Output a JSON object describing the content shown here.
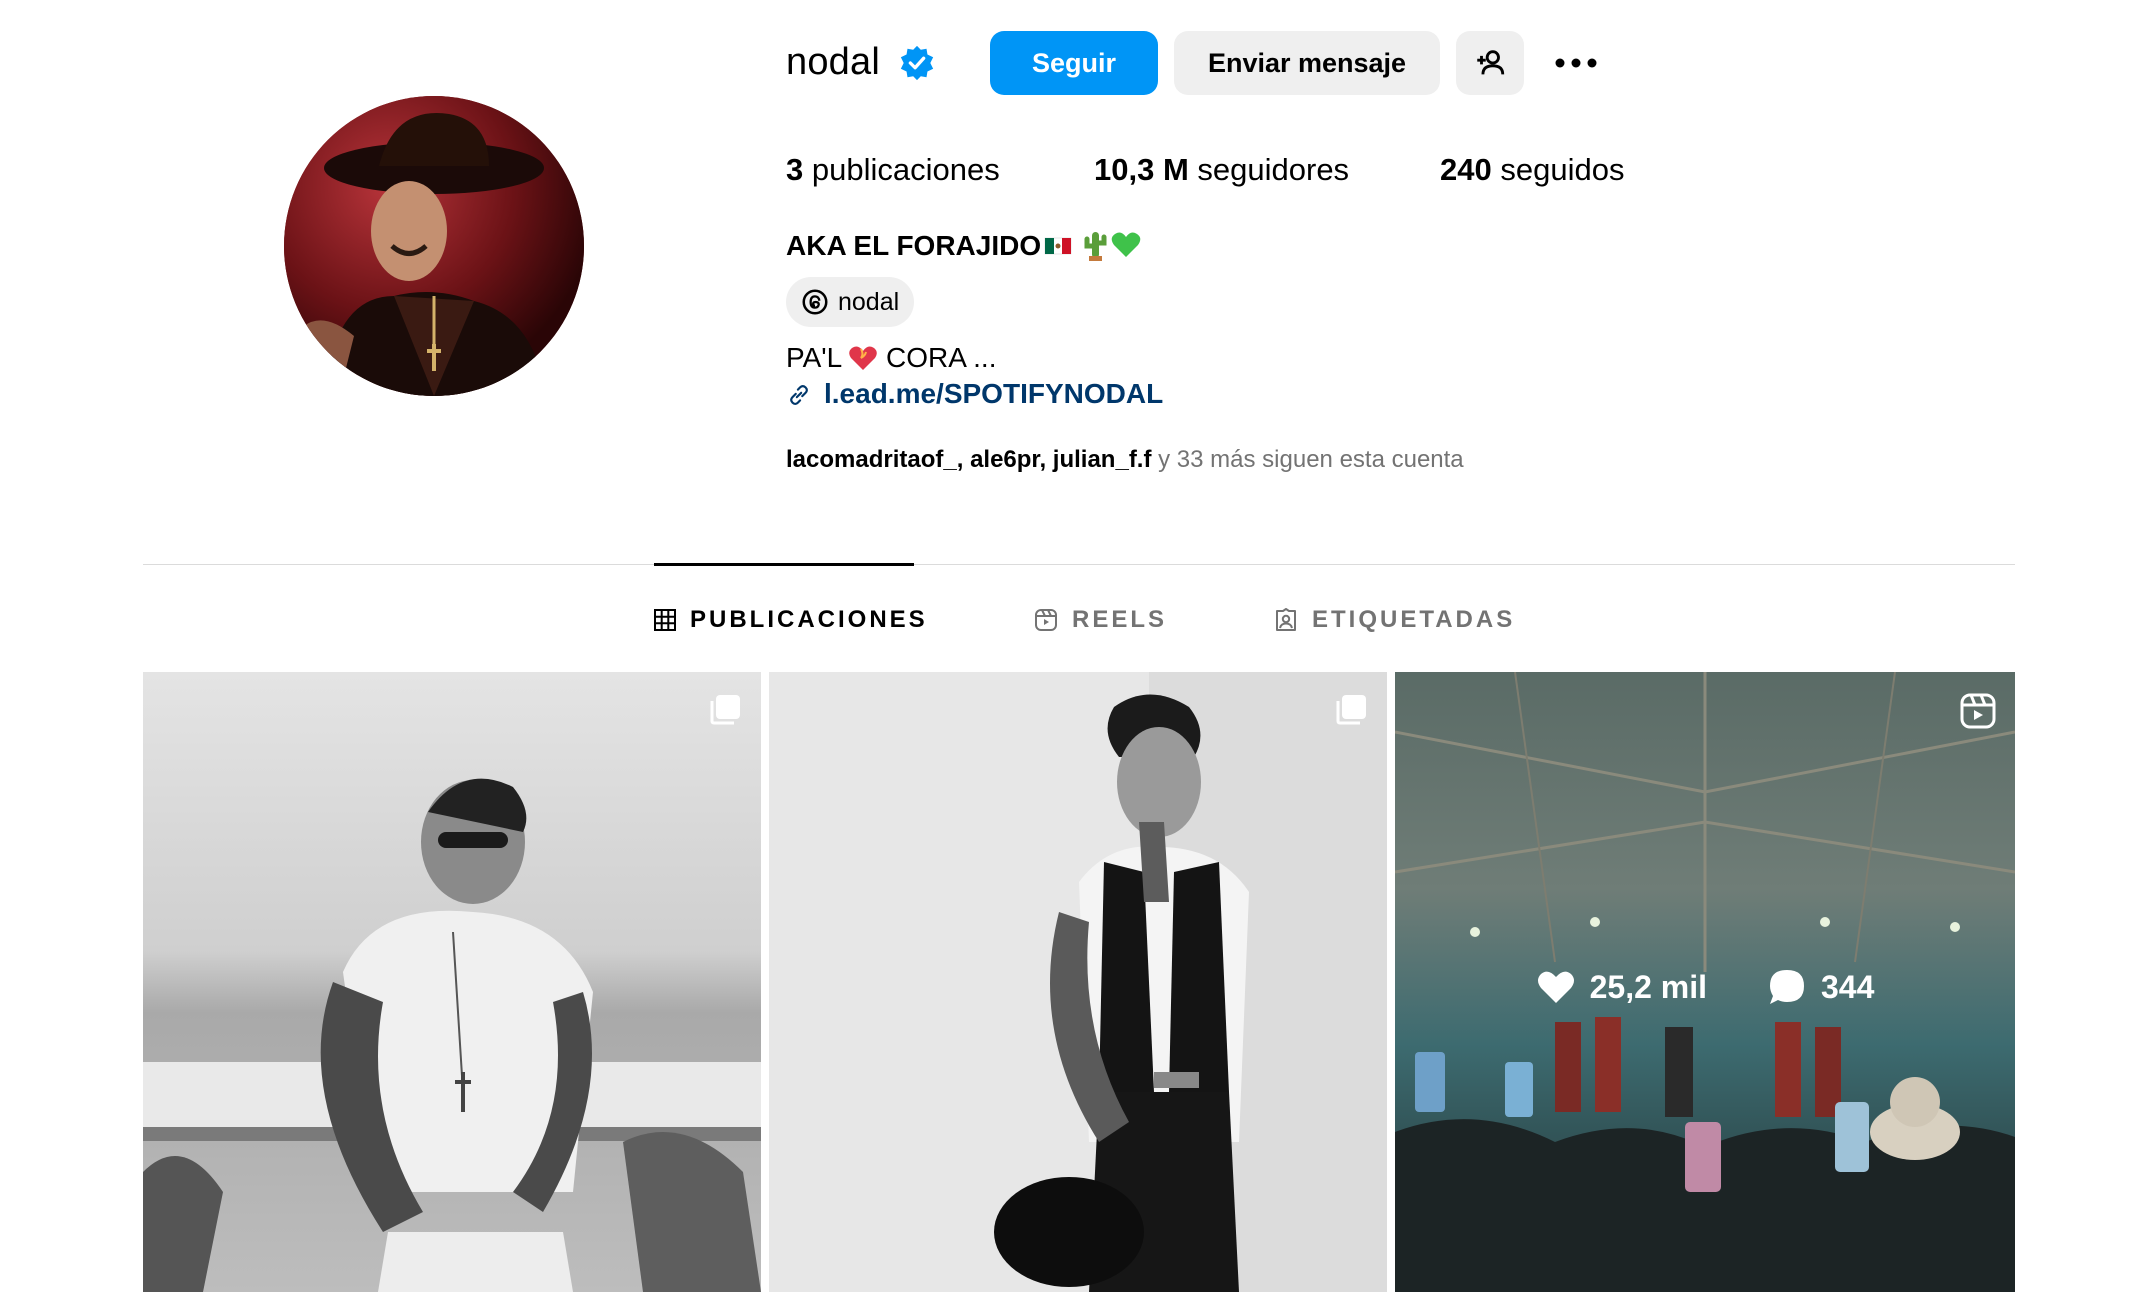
{
  "profile": {
    "username": "nodal",
    "verified": true,
    "follow_label": "Seguir",
    "message_label": "Enviar mensaje",
    "stats": {
      "posts_count": "3",
      "posts_label": "publicaciones",
      "followers_count": "10,3 M",
      "followers_label": "seguidores",
      "following_count": "240",
      "following_label": "seguidos"
    },
    "full_name": "AKA EL FORAJIDO",
    "threads_handle": "nodal",
    "bio_start": "PA'L",
    "bio_end": "CORA ...",
    "link": "l.ead.me/SPOTIFYNODAL",
    "followed_by": {
      "user1": "lacomadritaof_",
      "user2": "ale6pr",
      "user3": "julian_f.f",
      "rest": " y 33 más siguen esta cuenta"
    }
  },
  "tabs": {
    "posts": "PUBLICACIONES",
    "reels": "REELS",
    "tagged": "ETIQUETADAS"
  },
  "posts": [
    {
      "type": "carousel",
      "badge_icon": "carousel-icon"
    },
    {
      "type": "carousel",
      "badge_icon": "carousel-icon"
    },
    {
      "type": "reel",
      "badge_icon": "reel-icon",
      "likes": "25,2 mil",
      "comments": "344"
    }
  ],
  "colors": {
    "accent": "#0095f6",
    "link": "#00376b",
    "secondary_text": "#737373",
    "button_gray": "#efefef"
  }
}
